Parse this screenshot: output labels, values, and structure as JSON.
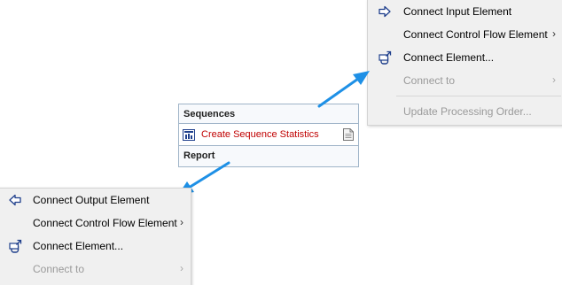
{
  "menu_top": {
    "items": [
      {
        "label": "Connect Input Element",
        "icon": "input-arrow-icon",
        "submenu": false,
        "disabled": false
      },
      {
        "label": "Connect Control Flow Element",
        "icon": "",
        "submenu": true,
        "disabled": false
      },
      {
        "label": "Connect Element...",
        "icon": "connect-element-icon",
        "submenu": false,
        "disabled": false
      },
      {
        "label": "Connect to",
        "icon": "",
        "submenu": true,
        "disabled": true
      },
      {
        "label": "Update Processing Order...",
        "icon": "",
        "submenu": false,
        "disabled": true
      }
    ]
  },
  "element_box": {
    "header": "Sequences",
    "item": "Create Sequence Statistics",
    "footer": "Report"
  },
  "menu_bottom": {
    "items": [
      {
        "label": "Connect Output Element",
        "icon": "output-arrow-icon",
        "submenu": false,
        "disabled": false
      },
      {
        "label": "Connect Control Flow Element",
        "icon": "",
        "submenu": true,
        "disabled": false
      },
      {
        "label": "Connect Element...",
        "icon": "connect-element-icon",
        "submenu": false,
        "disabled": false
      },
      {
        "label": "Connect to",
        "icon": "",
        "submenu": true,
        "disabled": true
      }
    ]
  },
  "submenu_glyph": "›",
  "colors": {
    "arrow": "#1e90e6",
    "accent_icon": "#1f3f8c",
    "error_red": "#c00000"
  }
}
